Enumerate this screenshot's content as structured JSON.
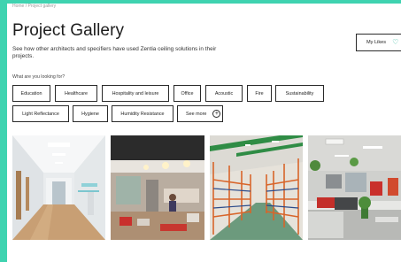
{
  "header": {
    "breadcrumb": "Home / Project gallery",
    "title": "Project Gallery",
    "subtitle": "See how other architects and specifiers have used Zentia ceiling solutions in their projects."
  },
  "likes": {
    "label": "My Likes",
    "icon": "heart-outline-icon"
  },
  "filters": {
    "question": "What are you looking for?",
    "items": [
      "Education",
      "Healthcare",
      "Hospitality and leisure",
      "Office",
      "Acoustic",
      "Fire",
      "Sustainability",
      "Light Reflectance",
      "Hygiene",
      "Humidity Resistance"
    ],
    "see_more": "See more",
    "see_more_icon": "plus-circle-icon"
  },
  "gallery": {
    "items": [
      {
        "name": "hospital-corridor-photo"
      },
      {
        "name": "cafeteria-photo"
      },
      {
        "name": "warehouse-photo"
      },
      {
        "name": "open-plan-office-photo"
      }
    ]
  },
  "colors": {
    "accent": "#2bb59b",
    "background": "#3fd3b0"
  }
}
